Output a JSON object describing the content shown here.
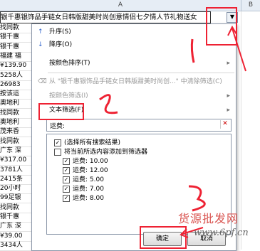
{
  "sheet": {
    "col_a": "A",
    "col_b": "B",
    "header_cell": "银千惠银饰品手链女日韩版甜美时尚创意情侣七夕情人节礼物送女",
    "rows": [
      "找同款",
      "银千惠",
      "银千惠",
      "福建 福",
      "¥139.90",
      "5258人",
      "26983",
      "按该运",
      "奥地利",
      "找同款",
      "奥地利",
      "茂来香",
      "找同款",
      "广东 深",
      "¥317.00",
      "3781人",
      "2415条",
      "20小时",
      "99足银",
      "找同款",
      "银千惠",
      "广东 深",
      "¥39.00",
      "3434人"
    ]
  },
  "menu": {
    "sort_asc": "升序(S)",
    "sort_desc": "降序(O)",
    "sort_color": "按颜色排序(T)",
    "clear_filter": "从 \"银千惠银饰品手链女日韩版甜美时尚创...\" 中清除筛选(C)",
    "filter_color": "按颜色筛选(I)",
    "text_filter": "文本筛选(F)",
    "search_value": "运费:",
    "list": [
      "(选择所有搜索结果)",
      "将当前所选内容添加到筛选器",
      "运费: 10.00",
      "运费: 12.00",
      "运费: 5.00",
      "运费: 7.00",
      "运费: 8.00"
    ],
    "ok": "确定",
    "cancel": "取消"
  },
  "annotations": {
    "n1": "1",
    "n2": "2",
    "n3": "3"
  },
  "watermark": {
    "text": "货源批发网",
    "url": "www.6pf.cn"
  }
}
